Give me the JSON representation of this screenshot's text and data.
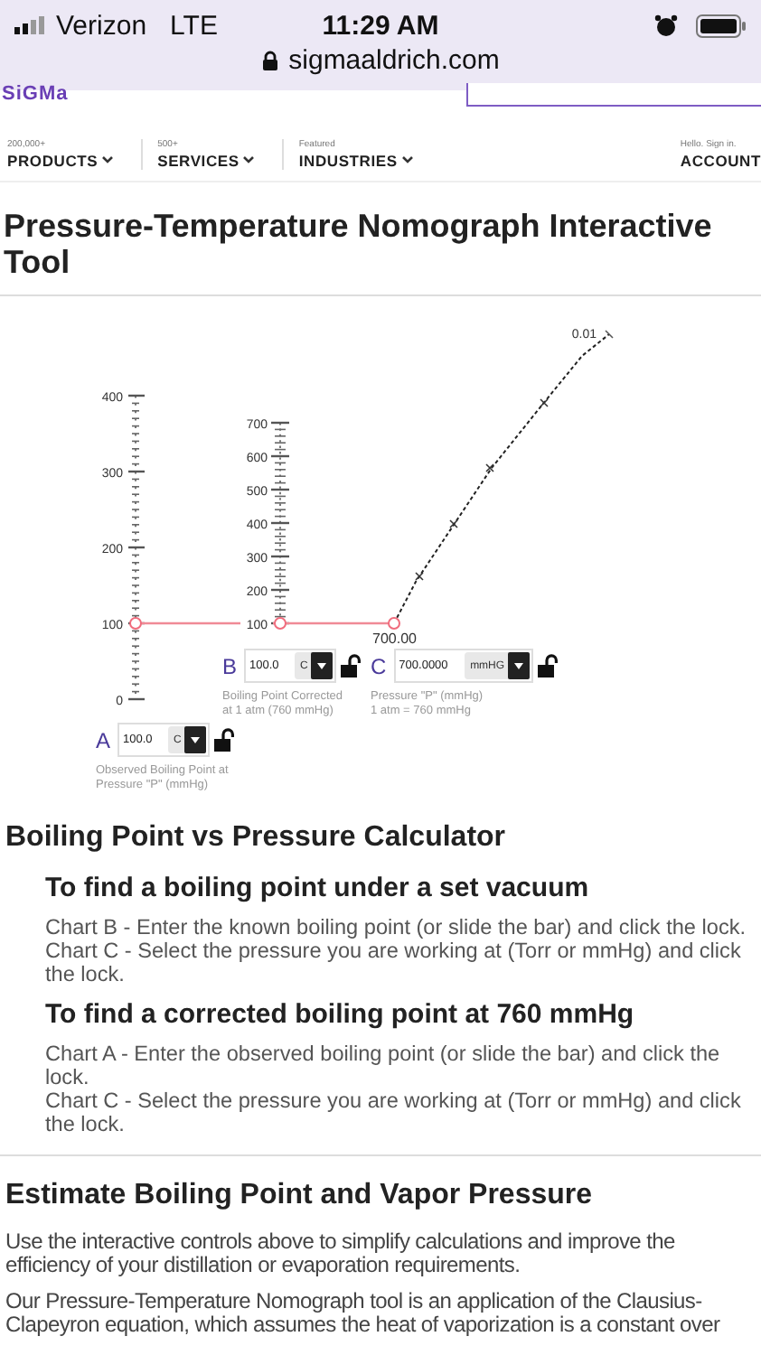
{
  "status_bar": {
    "carrier": "Verizon",
    "network": "LTE",
    "time": "11:29 AM"
  },
  "address_bar": {
    "url": "sigmaaldrich.com"
  },
  "header": {
    "logo": "SiGMa",
    "nav": [
      {
        "caption": "200,000+",
        "label": "PRODUCTS"
      },
      {
        "caption": "500+",
        "label": "SERVICES"
      },
      {
        "caption": "Featured",
        "label": "INDUSTRIES"
      }
    ],
    "account": {
      "caption": "Hello. Sign in.",
      "label": "ACCOUNT"
    }
  },
  "page_title": "Pressure-Temperature Nomograph Interactive Tool",
  "nomograph": {
    "scale_a_ticks": [
      "400",
      "300",
      "200",
      "100",
      "0"
    ],
    "scale_b_ticks": [
      "700",
      "600",
      "500",
      "400",
      "300",
      "200",
      "100"
    ],
    "curve_end_label": "0.01",
    "pressure_reading": "700.00",
    "controls": [
      {
        "letter": "B",
        "value": "100.0",
        "unit": "C",
        "locked": false,
        "caption": "Boiling Point Corrected\nat 1 atm (760 mmHg)"
      },
      {
        "letter": "C",
        "value": "700.0000",
        "unit": "mmHG",
        "locked": false,
        "caption": "Pressure \"P\" (mmHg)\n1 atm = 760 mmHg"
      },
      {
        "letter": "A",
        "value": "100.0",
        "unit": "C",
        "locked": false,
        "caption": "Observed Boiling Point at\nPressure \"P\" (mmHg)"
      }
    ]
  },
  "calculator": {
    "heading": "Boiling Point vs Pressure Calculator",
    "subsections": [
      {
        "heading": "To find a boiling point under a set vacuum",
        "paragraphs": [
          "Chart B - Enter the known boiling point (or slide the bar) and click the lock.",
          "Chart C - Select the pressure you are working at (Torr or mmHg) and click the lock."
        ]
      },
      {
        "heading": "To find a corrected boiling point at 760 mmHg",
        "paragraphs": [
          "Chart A - Enter the observed boiling point (or slide the bar) and click the lock.",
          "Chart C - Select the pressure you are working at (Torr or mmHg) and click the lock."
        ]
      }
    ]
  },
  "estimate": {
    "heading": "Estimate Boiling Point and Vapor Pressure",
    "paragraphs": [
      "Use the interactive controls above to simplify calculations and improve the efficiency of your distillation or evaporation requirements.",
      "Our Pressure-Temperature Nomograph tool is an application of the Clausius-Clapeyron equation, which assumes the heat of vaporization is a constant over"
    ]
  }
}
